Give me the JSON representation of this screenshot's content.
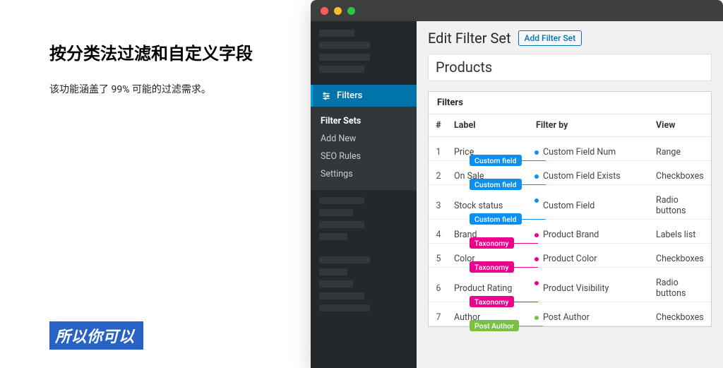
{
  "left": {
    "title": "按分类法过滤和自定义字段",
    "subtitle": "该功能涵盖了 99% 可能的过滤需求。",
    "tagline": "所以你可以"
  },
  "sidebar": {
    "active_label": "Filters",
    "submenu": [
      "Filter Sets",
      "Add New",
      "SEO Rules",
      "Settings"
    ]
  },
  "head": {
    "page_title": "Edit Filter Set",
    "add_button": "Add Filter Set",
    "set_name": "Products"
  },
  "panel": {
    "title": "Filters",
    "columns": {
      "num": "#",
      "label": "Label",
      "filterby": "Filter by",
      "view": "View"
    },
    "rows": [
      {
        "n": "1",
        "label": "Price",
        "source_tag": "Custom field",
        "source_color": "blue",
        "filterby": "Custom Field Num",
        "view": "Range"
      },
      {
        "n": "2",
        "label": "On Sale",
        "source_tag": "Custom field",
        "source_color": "blue",
        "filterby": "Custom Field Exists",
        "view": "Checkboxes"
      },
      {
        "n": "3",
        "label": "Stock status",
        "source_tag": "Custom field",
        "source_color": "blue",
        "filterby": "Custom Field",
        "view": "Radio buttons"
      },
      {
        "n": "4",
        "label": "Brand",
        "source_tag": "Taxonomy",
        "source_color": "pink",
        "filterby": "Product Brand",
        "view": "Labels list"
      },
      {
        "n": "5",
        "label": "Color",
        "source_tag": "Taxonomy",
        "source_color": "pink",
        "filterby": "Product Color",
        "view": "Checkboxes"
      },
      {
        "n": "6",
        "label": "Product Rating",
        "source_tag": "Taxonomy",
        "source_color": "pink",
        "filterby": "Product Visibility",
        "view": "Radio buttons"
      },
      {
        "n": "7",
        "label": "Author",
        "source_tag": "Post Author",
        "source_color": "green",
        "filterby": "Post Author",
        "view": "Checkboxes"
      }
    ]
  }
}
